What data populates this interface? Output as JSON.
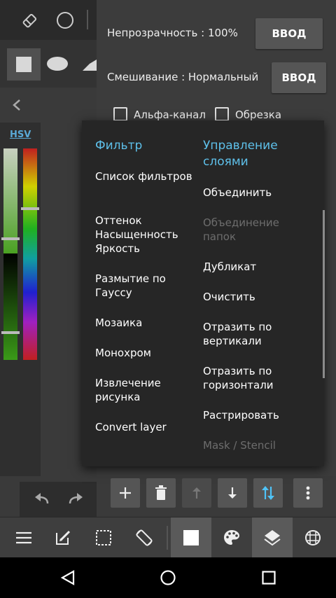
{
  "properties": {
    "opacity_label": "Непрозрачность : 100%",
    "blend_label": "Смешивание : Нормальный",
    "enter_button": "ВВОД",
    "alpha_label": "Альфа-канал",
    "clip_label": "Обрезка"
  },
  "color": {
    "mode_label": "HSV"
  },
  "popup": {
    "filter_header": "Фильтр",
    "filter_items": [
      "Список фильтров",
      "Оттенок Насыщенность Яркость",
      "Размытие по Гауссу",
      "Мозаика",
      "Монохром",
      "Извлечение рисунка",
      "Convert layer"
    ],
    "layers_header": "Управление слоями",
    "layer_items": [
      "Объединить",
      "Объединение папок",
      "Дубликат",
      "Очистить",
      "Отразить по вертикали",
      "Отразить по горизонтали",
      "Растрировать",
      "Mask / Stencil"
    ]
  },
  "colors": {
    "accent": "#5ec0ea",
    "disabled_text": "#6d6d6d",
    "background": "#3a3a3a"
  }
}
